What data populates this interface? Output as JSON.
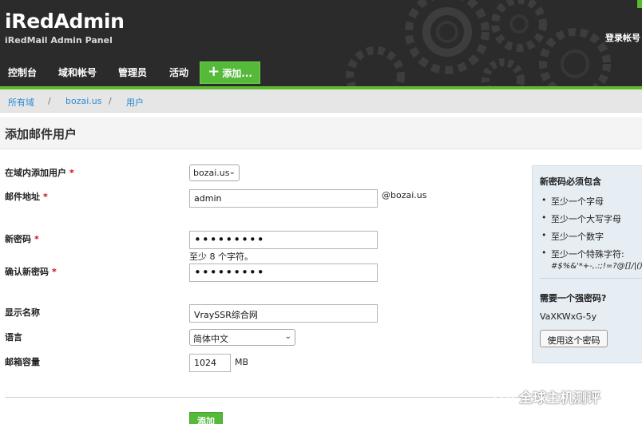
{
  "header": {
    "brand_title": "iRedAdmin",
    "brand_subtitle": "iRedMail Admin Panel",
    "account_link": "登录帐号"
  },
  "nav": {
    "items": [
      "控制台",
      "域和帐号",
      "管理员",
      "活动"
    ],
    "add_label": "添加..."
  },
  "breadcrumb": {
    "items": [
      "所有域",
      "bozai.us",
      "用户"
    ],
    "separator": "/"
  },
  "page_title": "添加邮件用户",
  "form": {
    "domain": {
      "label": "在域内添加用户",
      "value": "bozai.us",
      "required_mark": "*"
    },
    "email": {
      "label": "邮件地址",
      "value": "admin",
      "suffix": "@bozai.us",
      "required_mark": "*"
    },
    "new_password": {
      "label": "新密码",
      "value": "•••••••••",
      "hint": "至少 8 个字符。",
      "required_mark": "*"
    },
    "confirm_password": {
      "label": "确认新密码",
      "value": "•••••••••",
      "required_mark": "*"
    },
    "display_name": {
      "label": "显示名称",
      "value": "VraySSR综合网"
    },
    "language": {
      "label": "语言",
      "value": "简体中文"
    },
    "quota": {
      "label": "邮箱容量",
      "value": "1024",
      "unit": "MB"
    },
    "submit_label": "添加"
  },
  "password_panel": {
    "title": "新密码必须包含",
    "rules": [
      "至少一个字母",
      "至少一个大写字母",
      "至少一个数字",
      "至少一个特殊字符:"
    ],
    "special_chars": "#$%&'*+-,.:;!=?@[]/|(){}_`",
    "strong_question": "需要一个强密码?",
    "strong_password": "VaXKWxG-5y",
    "use_button": "使用这个密码"
  },
  "watermark": "全球主机测评",
  "colors": {
    "accent_green": "#5cb82c",
    "link_blue": "#2b8ad1",
    "header_dark": "#2b2b2b"
  }
}
